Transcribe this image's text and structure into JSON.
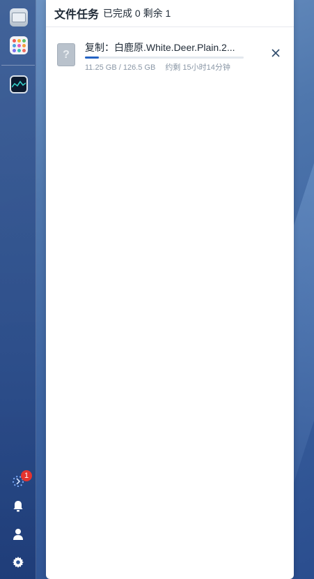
{
  "panel": {
    "title": "文件任务",
    "summary": "已完成 0 剩余 1"
  },
  "tasks": [
    {
      "title": "复制：白鹿原.White.Deer.Plain.2...",
      "progress": 0.089,
      "size": "11.25 GB / 126.5 GB",
      "eta": "约剩 15小时14分钟",
      "icon": "unknown-file-icon"
    }
  ],
  "dock": {
    "apps": [
      "desktop-monitor-icon",
      "app-launcher-icon",
      "resource-monitor-icon"
    ],
    "tray": {
      "tasks_icon": "spinner-icon",
      "tasks_badge": "1",
      "notifications_icon": "bell-icon",
      "user_icon": "user-icon",
      "settings_icon": "gear-icon"
    }
  },
  "colors": {
    "accent": "#2463c4",
    "badge": "#e3342f"
  }
}
